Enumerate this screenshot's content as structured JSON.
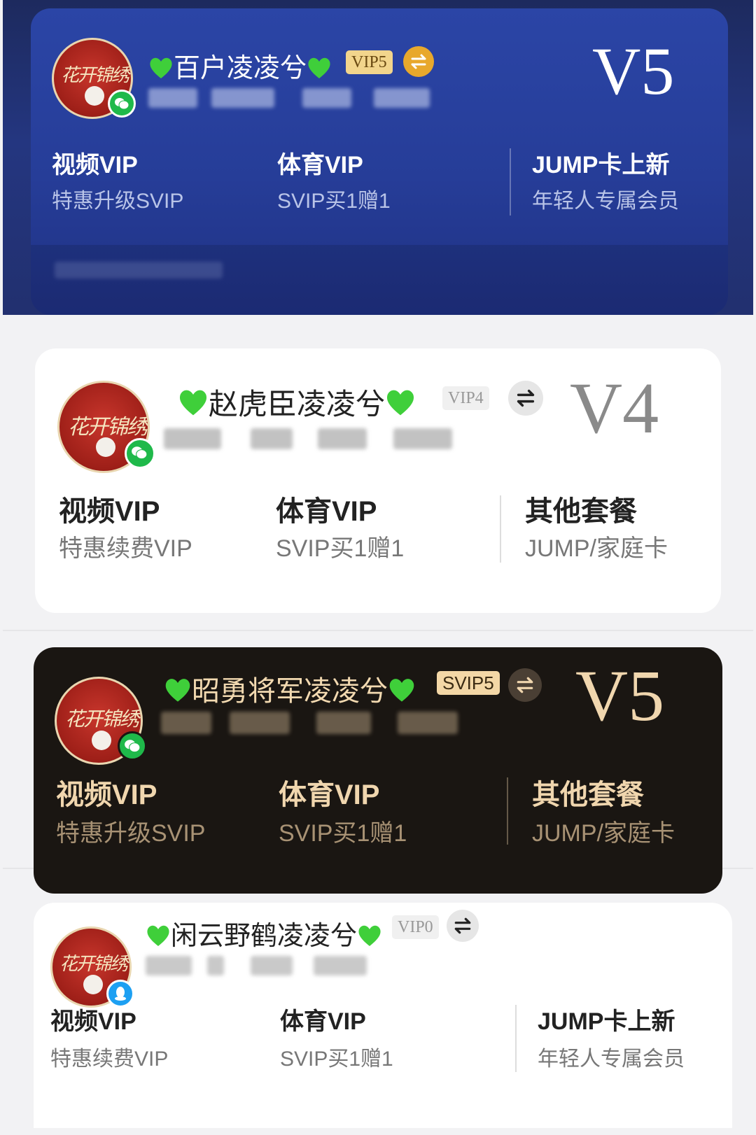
{
  "cards": [
    {
      "name_text": "百户凌凌兮",
      "vip_tag": "VIP5",
      "level": "V5",
      "login": "wechat",
      "columns": [
        {
          "title": "视频VIP",
          "sub": "特惠升级SVIP"
        },
        {
          "title": "体育VIP",
          "sub": "SVIP买1赠1"
        },
        {
          "title": "JUMP卡上新",
          "sub": "年轻人专属会员"
        }
      ]
    },
    {
      "name_text": "赵虎臣凌凌兮",
      "vip_tag": "VIP4",
      "level": "V4",
      "login": "wechat",
      "columns": [
        {
          "title": "视频VIP",
          "sub": "特惠续费VIP"
        },
        {
          "title": "体育VIP",
          "sub": "SVIP买1赠1"
        },
        {
          "title": "其他套餐",
          "sub": "JUMP/家庭卡"
        }
      ]
    },
    {
      "name_text": "昭勇将军凌凌兮",
      "vip_tag": "SVIP5",
      "level": "V5",
      "login": "wechat",
      "columns": [
        {
          "title": "视频VIP",
          "sub": "特惠升级SVIP"
        },
        {
          "title": "体育VIP",
          "sub": "SVIP买1赠1"
        },
        {
          "title": "其他套餐",
          "sub": "JUMP/家庭卡"
        }
      ]
    },
    {
      "name_text": "闲云野鹤凌凌兮",
      "vip_tag": "VIP0",
      "level": "",
      "login": "qq",
      "columns": [
        {
          "title": "视频VIP",
          "sub": "特惠续费VIP"
        },
        {
          "title": "体育VIP",
          "sub": "SVIP买1赠1"
        },
        {
          "title": "JUMP卡上新",
          "sub": "年轻人专属会员"
        }
      ]
    }
  ],
  "icons": {
    "heart": "green-heart-emoji",
    "swap": "swap-arrows-icon",
    "wechat": "wechat-icon",
    "qq": "qq-icon"
  },
  "colors": {
    "card1_bg": "#263d98",
    "card2_bg": "#ffffff",
    "card3_bg": "#1a1612",
    "card4_bg": "#ffffff",
    "heart": "#3fcf3a",
    "gold": "#f0d6ae"
  }
}
